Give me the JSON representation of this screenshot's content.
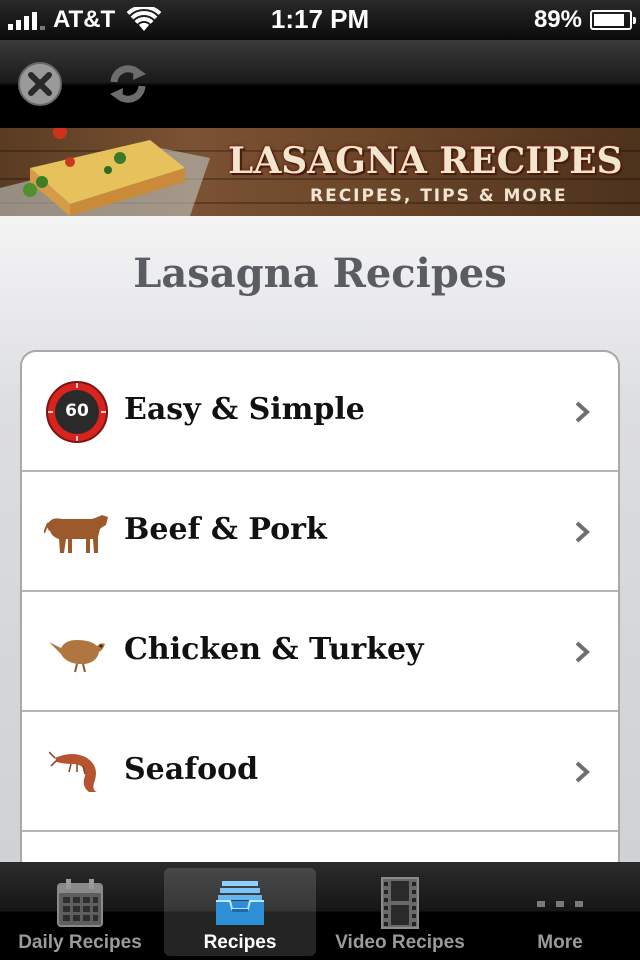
{
  "status_bar": {
    "carrier": "AT&T",
    "time": "1:17 PM",
    "battery_percent": "89%",
    "battery_level": 0.89,
    "signal_bars": 4,
    "wifi_icon": "wifi-icon"
  },
  "toolbar": {
    "close_icon": "close-icon",
    "refresh_icon": "refresh-icon"
  },
  "banner": {
    "title": "LASAGNA RECIPES",
    "subtitle": "RECIPES, TIPS & MORE"
  },
  "page": {
    "title": "Lasagna Recipes"
  },
  "menu": {
    "items": [
      {
        "label": "Easy & Simple",
        "icon": "timer-icon",
        "timer_text": "60"
      },
      {
        "label": "Beef & Pork",
        "icon": "cow-icon"
      },
      {
        "label": "Chicken & Turkey",
        "icon": "chicken-icon"
      },
      {
        "label": "Seafood",
        "icon": "shrimp-icon"
      }
    ]
  },
  "tabbar": {
    "tabs": [
      {
        "label": "Daily Recipes",
        "icon": "calendar-icon",
        "active": false
      },
      {
        "label": "Recipes",
        "icon": "inbox-tray-icon",
        "active": true
      },
      {
        "label": "Video Recipes",
        "icon": "film-strip-icon",
        "active": false
      },
      {
        "label": "More",
        "icon": "more-dots-icon",
        "active": false
      }
    ]
  },
  "colors": {
    "accent_blue": "#3aa3e6",
    "title_gray": "#595c61",
    "timer_red": "#d9231e",
    "animal_brown": "#9c5a2c"
  }
}
